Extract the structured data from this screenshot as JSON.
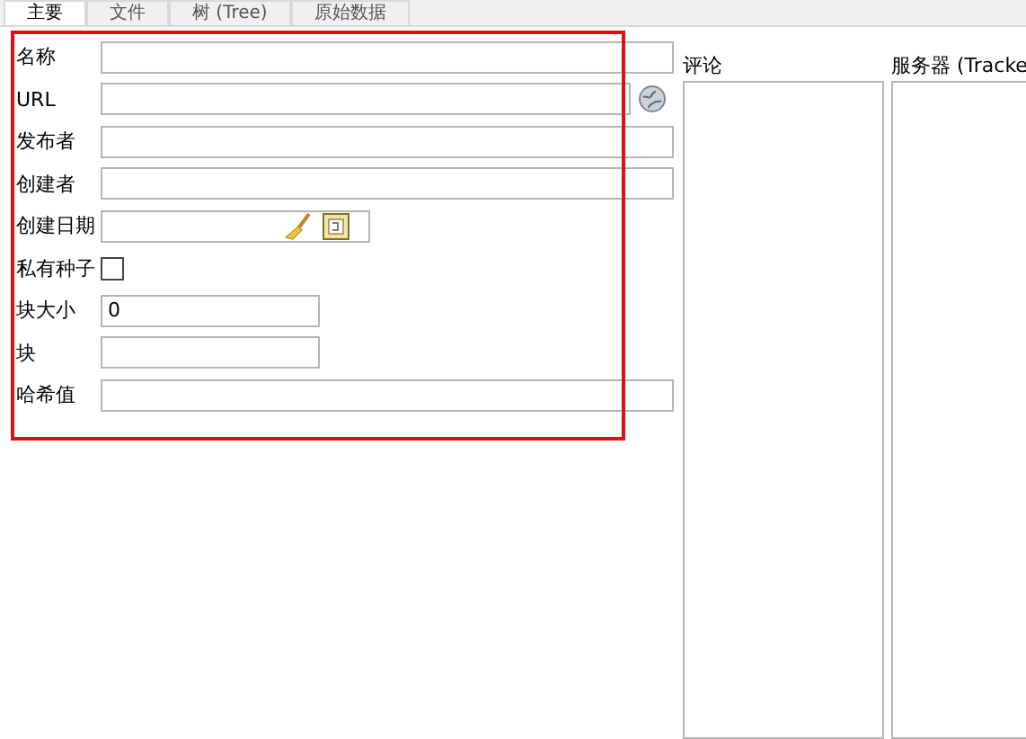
{
  "tabs": [
    {
      "label": "主要",
      "selected": true
    },
    {
      "label": "文件",
      "selected": false
    },
    {
      "label": "树 (Tree)",
      "selected": false
    },
    {
      "label": "原始数据",
      "selected": false
    }
  ],
  "fields": [
    {
      "kind": "text",
      "label": "名称"
    },
    {
      "kind": "url",
      "label": "URL"
    },
    {
      "kind": "text",
      "label": "发布者"
    },
    {
      "kind": "text",
      "label": "创建者"
    },
    {
      "kind": "date",
      "label": "创建日期"
    },
    {
      "kind": "checkbox",
      "label": "私有种子",
      "checked": false
    },
    {
      "kind": "short",
      "label": "块大小",
      "value": "0"
    },
    {
      "kind": "short",
      "label": "块"
    },
    {
      "kind": "text",
      "label": "哈希值"
    }
  ],
  "comment": {
    "label": "评论"
  },
  "trackers": {
    "label": "服务器 (Tracke"
  }
}
